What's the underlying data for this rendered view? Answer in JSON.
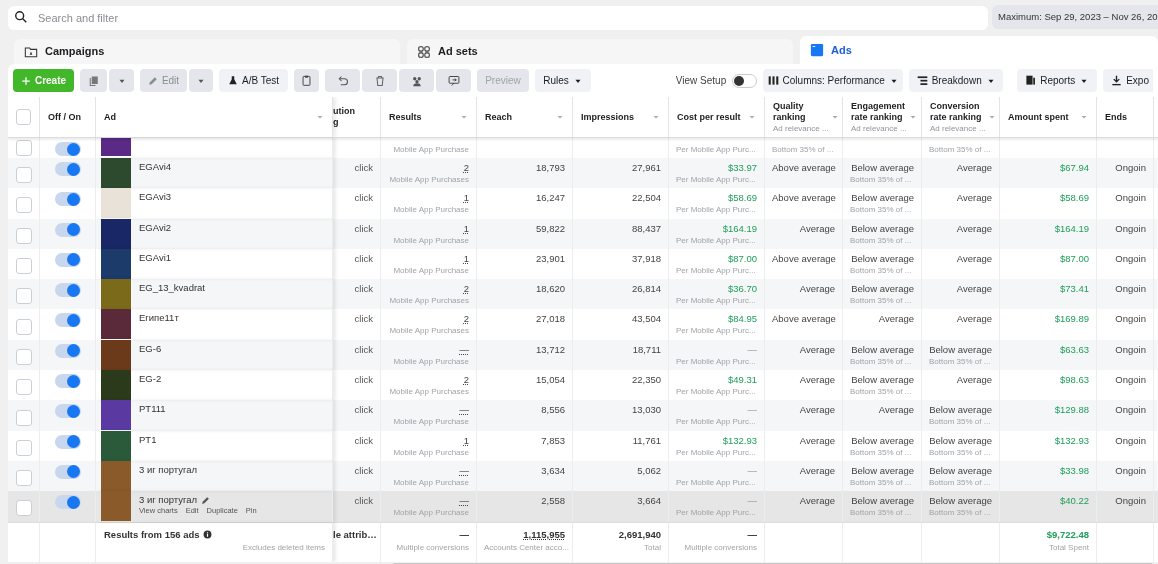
{
  "search": {
    "placeholder": "Search and filter"
  },
  "date_range": "Maximum: Sep 29, 2023 – Nov 26, 20",
  "tabs": [
    {
      "label": "Campaigns",
      "kind": "campaigns",
      "selected": false
    },
    {
      "label": "Ad sets",
      "kind": "adsets",
      "selected": false
    },
    {
      "label": "Ads",
      "kind": "ads",
      "selected": true
    }
  ],
  "toolbar": {
    "create": "Create",
    "edit": "Edit",
    "ab_test": "A/B Test",
    "preview": "Preview",
    "rules": "Rules",
    "view_setup": {
      "label": "View Setup",
      "on": false
    },
    "columns": "Columns: Performance",
    "breakdown": "Breakdown",
    "reports": "Reports",
    "export": "Expo"
  },
  "table": {
    "select_all_checked": false,
    "columns": [
      {
        "kind": "check"
      },
      {
        "kind": "toggle",
        "label": "Off / On"
      },
      {
        "kind": "ad",
        "label": "Ad"
      },
      {
        "kind": "attribution",
        "label": "ution",
        "label2": "g"
      },
      {
        "kind": "results",
        "label": "Results"
      },
      {
        "kind": "reach",
        "label": "Reach"
      },
      {
        "kind": "impressions",
        "label": "Impressions"
      },
      {
        "kind": "cpr",
        "label": "Cost per result"
      },
      {
        "kind": "quality",
        "label": "Quality ranking",
        "sub": "Ad relevance ..."
      },
      {
        "kind": "engagement",
        "label": "Engagement rate ranking",
        "sub": "Ad relevance ..."
      },
      {
        "kind": "conversion",
        "label": "Conversion rate ranking",
        "sub": "Ad relevance ..."
      },
      {
        "kind": "spent",
        "label": "Amount spent"
      },
      {
        "kind": "ends",
        "label": "Ends"
      }
    ],
    "rows": [
      {
        "partial": true,
        "selected": false,
        "on": true,
        "results_sub": "Mobile App Purchase",
        "cpr_sub": "Per Mobile App Purc...",
        "quality_sub": "Bottom 35% of ...",
        "conversion_sub": "Bottom 35% of ..."
      },
      {
        "name": "EGAvi4",
        "selected": false,
        "on": true,
        "attribution": "click",
        "results": "2",
        "results_sub": "Mobile App Purchases",
        "reach": "18,793",
        "impressions": "27,961",
        "cpr": "$33.97",
        "cpr_sub": "Per Mobile App Purc...",
        "quality": "Above average",
        "engagement": "Below average",
        "engagement_sub": "Bottom 35% of ...",
        "conversion": "Average",
        "spent": "$67.94",
        "ends": "Ongoin"
      },
      {
        "name": "EGAvi3",
        "selected": false,
        "on": true,
        "attribution": "click",
        "results": "1",
        "results_sub": "Mobile App Purchase",
        "reach": "16,247",
        "impressions": "22,504",
        "cpr": "$58.69",
        "cpr_sub": "Per Mobile App Purc...",
        "quality": "Above average",
        "engagement": "Below average",
        "engagement_sub": "Bottom 35% of ...",
        "conversion": "Average",
        "spent": "$58.69",
        "ends": "Ongoin"
      },
      {
        "name": "EGAvi2",
        "selected": false,
        "on": true,
        "attribution": "click",
        "results": "1",
        "results_sub": "Mobile App Purchase",
        "reach": "59,822",
        "impressions": "88,437",
        "cpr": "$164.19",
        "cpr_sub": "Per Mobile App Purc...",
        "quality": "Average",
        "engagement": "Below average",
        "engagement_sub": "Bottom 35% of ...",
        "conversion": "Average",
        "spent": "$164.19",
        "ends": "Ongoin"
      },
      {
        "name": "EGAvi1",
        "selected": false,
        "on": true,
        "attribution": "click",
        "results": "1",
        "results_sub": "Mobile App Purchase",
        "reach": "23,901",
        "impressions": "37,918",
        "cpr": "$87.00",
        "cpr_sub": "Per Mobile App Purc...",
        "quality": "Above average",
        "engagement": "Below average",
        "engagement_sub": "Bottom 35% of ...",
        "conversion": "Average",
        "spent": "$87.00",
        "ends": "Ongoin"
      },
      {
        "name": "EG_13_kvadrat",
        "selected": false,
        "on": true,
        "attribution": "click",
        "results": "2",
        "results_sub": "Mobile App Purchases",
        "reach": "18,620",
        "impressions": "26,814",
        "cpr": "$36.70",
        "cpr_sub": "Per Mobile App Purc...",
        "quality": "Average",
        "engagement": "Below average",
        "engagement_sub": "Bottom 35% of ...",
        "conversion": "Average",
        "spent": "$73.41",
        "ends": "Ongoin"
      },
      {
        "name": "Египе11т",
        "selected": false,
        "on": true,
        "attribution": "click",
        "results": "2",
        "results_sub": "Mobile App Purchases",
        "reach": "27,018",
        "impressions": "43,504",
        "cpr": "$84.95",
        "cpr_sub": "Per Mobile App Purc...",
        "quality": "Above average",
        "engagement": "Average",
        "conversion": "Average",
        "spent": "$169.89",
        "ends": "Ongoin"
      },
      {
        "name": "EG-6",
        "selected": false,
        "on": true,
        "attribution": "click",
        "results": "—",
        "results_sub": "Mobile App Purchase",
        "reach": "13,712",
        "impressions": "18,711",
        "cpr": "—",
        "cpr_sub": "Per Mobile App Purc...",
        "quality": "Average",
        "engagement": "Below average",
        "engagement_sub": "Bottom 35% of ...",
        "conversion": "Below average",
        "conversion_sub": "Bottom 35% of ...",
        "spent": "$63.63",
        "ends": "Ongoin"
      },
      {
        "name": "EG-2",
        "selected": false,
        "on": true,
        "attribution": "click",
        "results": "2",
        "results_sub": "Mobile App Purchases",
        "reach": "15,054",
        "impressions": "22,350",
        "cpr": "$49.31",
        "cpr_sub": "Per Mobile App Purc...",
        "quality": "Average",
        "engagement": "Below average",
        "engagement_sub": "Bottom 35% of ...",
        "conversion": "Average",
        "spent": "$98.63",
        "ends": "Ongoin"
      },
      {
        "name": "PT111",
        "selected": false,
        "on": true,
        "attribution": "click",
        "results": "—",
        "results_sub": "Mobile App Purchase",
        "reach": "8,556",
        "impressions": "13,030",
        "cpr": "—",
        "cpr_sub": "Per Mobile App Purc...",
        "quality": "Average",
        "engagement": "Average",
        "conversion": "Below average",
        "conversion_sub": "Bottom 35% of ...",
        "spent": "$129.88",
        "ends": "Ongoin"
      },
      {
        "name": "PT1",
        "selected": false,
        "on": true,
        "attribution": "click",
        "results": "1",
        "results_sub": "Mobile App Purchase",
        "reach": "7,853",
        "impressions": "11,761",
        "cpr": "$132.93",
        "cpr_sub": "Per Mobile App Purc...",
        "quality": "Average",
        "engagement": "Below average",
        "engagement_sub": "Bottom 35% of ...",
        "conversion": "Below average",
        "conversion_sub": "Bottom 35% of ...",
        "spent": "$132.93",
        "ends": "Ongoin"
      },
      {
        "name": "3 иг португал",
        "selected": false,
        "on": true,
        "attribution": "click",
        "results": "—",
        "results_sub": "Mobile App Purchase",
        "reach": "3,634",
        "impressions": "5,062",
        "cpr": "—",
        "cpr_sub": "Per Mobile App Purc...",
        "quality": "Average",
        "engagement": "Below average",
        "engagement_sub": "Bottom 35% of ...",
        "conversion": "Below average",
        "conversion_sub": "Bottom 35% of ...",
        "spent": "$33.98",
        "ends": "Ongoin"
      },
      {
        "name": "3 иг португал",
        "selected": false,
        "on": true,
        "hovered": true,
        "actions": [
          "View charts",
          "Edit",
          "Duplicate",
          "Pin"
        ],
        "attribution": "click",
        "results": "—",
        "results_sub": "Mobile App Purchase",
        "reach": "2,558",
        "impressions": "3,664",
        "cpr": "—",
        "cpr_sub": "Per Mobile App Purc...",
        "quality": "Average",
        "engagement": "Below average",
        "engagement_sub": "Bottom 35% of ...",
        "conversion": "Below average",
        "conversion_sub": "Bottom 35% of ...",
        "spent": "$40.22",
        "ends": "Ongoin"
      }
    ],
    "footer": {
      "ad": "Results from 156 ads",
      "ad_sub": "Excludes deleted items",
      "attribution": "le attrib…",
      "results": "—",
      "results_sub": "Multiple conversions",
      "reach": "1,115,955",
      "reach_sub": "Accounts Center acco...",
      "impressions": "2,691,940",
      "impressions_sub": "Total",
      "cpr": "—",
      "cpr_sub": "Multiple conversions",
      "spent": "$9,722.48",
      "spent_sub": "Total Spent"
    }
  }
}
